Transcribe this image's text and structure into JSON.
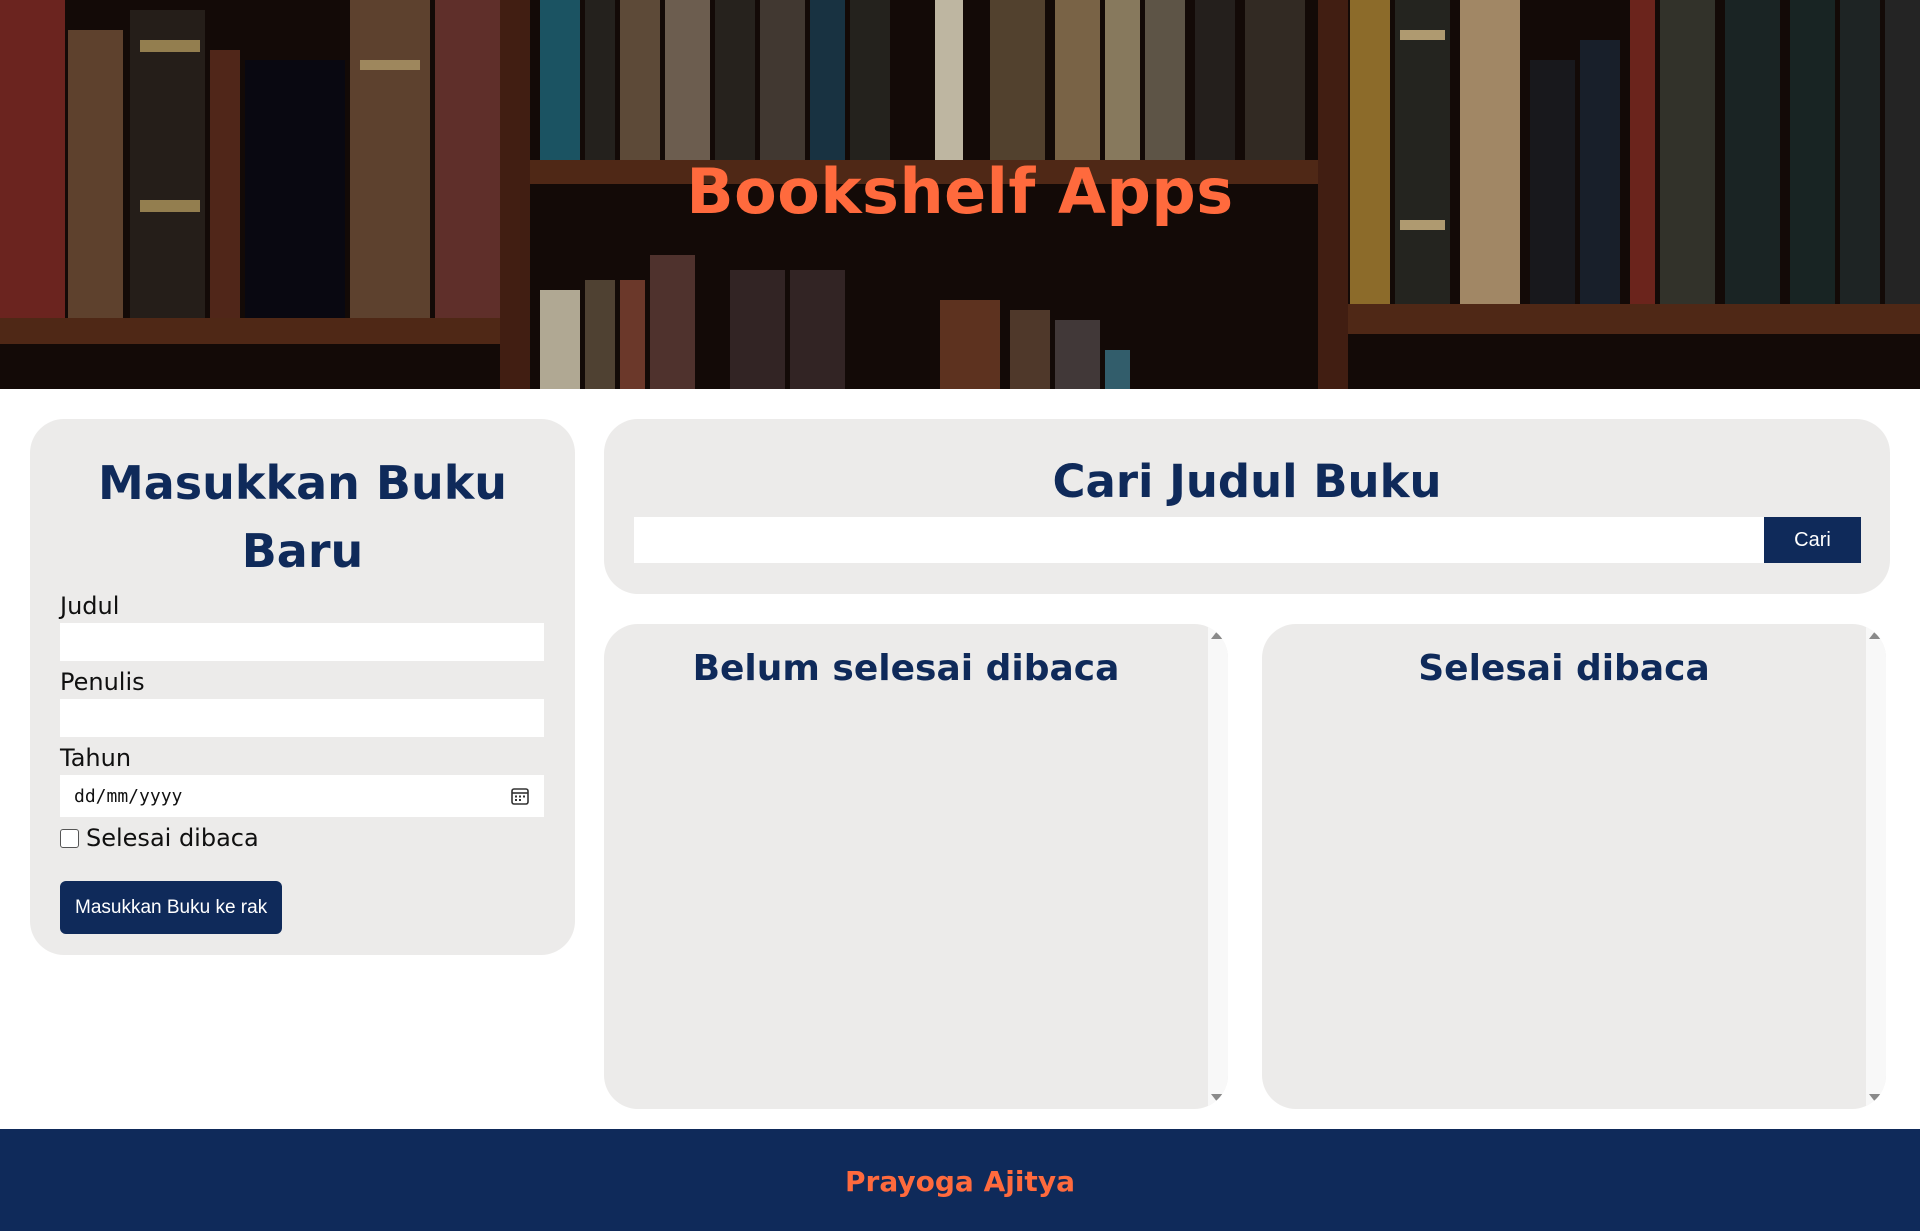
{
  "header": {
    "title": "Bookshelf Apps"
  },
  "add_book": {
    "title": "Masukkan Buku Baru",
    "title_line1": "Masukkan Buku",
    "title_line2": "Baru",
    "fields": {
      "judul_label": "Judul",
      "judul_value": "",
      "penulis_label": "Penulis",
      "penulis_value": "",
      "tahun_label": "Tahun",
      "tahun_placeholder": "dd/mm/yyyy"
    },
    "checkbox_label": "Selesai dibaca",
    "checkbox_checked": false,
    "submit_label": "Masukkan Buku ke rak"
  },
  "search": {
    "title": "Cari Judul Buku",
    "input_value": "",
    "button_label": "Cari"
  },
  "shelves": {
    "incomplete_title": "Belum selesai dibaca",
    "complete_title": "Selesai dibaca"
  },
  "footer": {
    "text": "Prayoga Ajitya"
  },
  "colors": {
    "accent": "#ff6a3d",
    "navy": "#0f2a5a",
    "card_bg": "#ecebea"
  },
  "icons": [
    "calendar-icon",
    "scroll-up-icon",
    "scroll-down-icon"
  ]
}
